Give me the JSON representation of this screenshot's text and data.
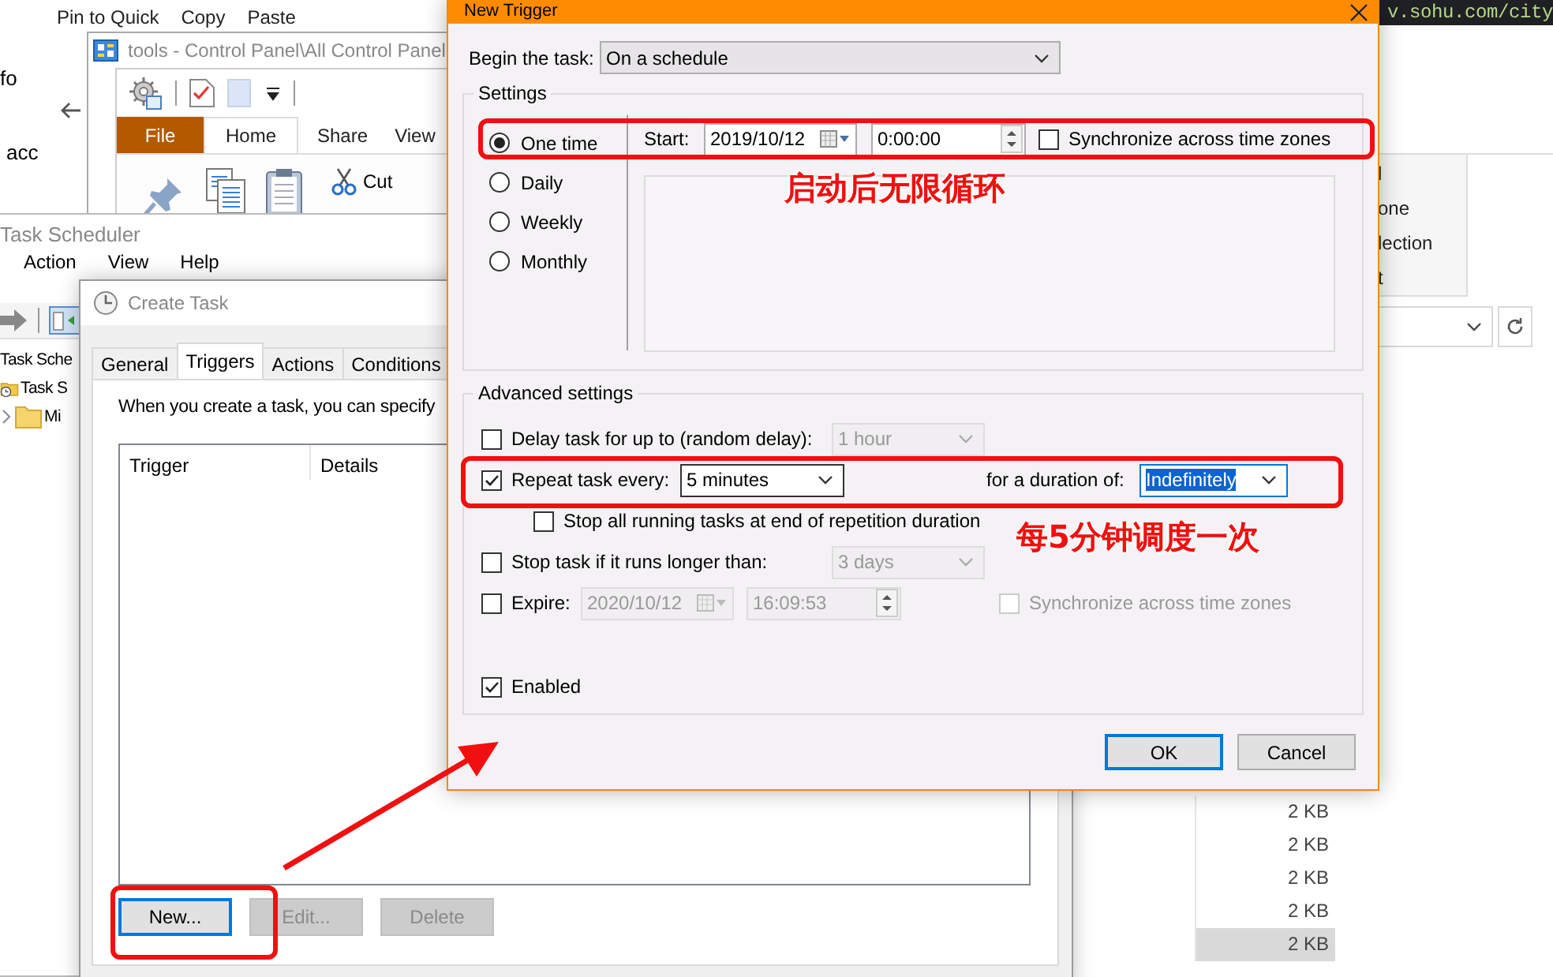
{
  "background_window": {
    "ribbon_labels": [
      "Pin to Quick",
      "Copy",
      "Paste"
    ],
    "side_texts": [
      "fo",
      "acc"
    ],
    "url_text": "v.sohu.com/city",
    "ribbon_fragments": [
      "l",
      "one",
      "lection",
      "t"
    ],
    "files": [
      {
        "size": "2 KB",
        "selected": false
      },
      {
        "size": "2 KB",
        "selected": false
      },
      {
        "size": "2 KB",
        "selected": false
      },
      {
        "size": "2 KB",
        "selected": false
      },
      {
        "size": "2 KB",
        "selected": true
      }
    ]
  },
  "tools_window": {
    "title": "tools - Control Panel\\All Control Panel",
    "ribbon_tabs": [
      {
        "label": "File",
        "kind": "file",
        "selected": false
      },
      {
        "label": "Home",
        "kind": "tab",
        "selected": true
      },
      {
        "label": "Share",
        "kind": "tab",
        "selected": false
      },
      {
        "label": "View",
        "kind": "tab",
        "selected": false
      }
    ],
    "commands": [
      "Cut"
    ]
  },
  "task_scheduler": {
    "title": "Task Scheduler",
    "menu": [
      "Action",
      "View",
      "Help"
    ],
    "pane_header": "Task Sche",
    "tree": [
      {
        "label": "Task S",
        "children": [
          {
            "label": "Mi",
            "expanded": false
          }
        ]
      }
    ]
  },
  "create_task": {
    "title": "Create Task",
    "tabs": [
      {
        "label": "General",
        "selected": false
      },
      {
        "label": "Triggers",
        "selected": true
      },
      {
        "label": "Actions",
        "selected": false
      },
      {
        "label": "Conditions",
        "selected": false
      }
    ],
    "intro": "When you create a task, you can specify",
    "columns": [
      "Trigger",
      "Details"
    ],
    "buttons": [
      {
        "label": "New...",
        "disabled": false,
        "focused": true
      },
      {
        "label": "Edit...",
        "disabled": true,
        "focused": false
      },
      {
        "label": "Delete",
        "disabled": true,
        "focused": false
      }
    ]
  },
  "new_trigger": {
    "title": "New Trigger",
    "begin_label": "Begin the task:",
    "begin_value": "On a schedule",
    "settings": {
      "title": "Settings",
      "schedules": [
        {
          "label": "One time",
          "selected": true
        },
        {
          "label": "Daily",
          "selected": false
        },
        {
          "label": "Weekly",
          "selected": false
        },
        {
          "label": "Monthly",
          "selected": false
        }
      ],
      "start_label": "Start:",
      "start_date": "2019/10/12",
      "start_time": "0:00:00",
      "sync_label": "Synchronize across time zones",
      "sync_checked": false
    },
    "advanced": {
      "title": "Advanced settings",
      "rows": [
        {
          "kind": "option",
          "label": "Delay task for up to (random delay):",
          "checked": false,
          "value": "1 hour",
          "disabled": true
        },
        {
          "kind": "repeat",
          "label": "Repeat task every:",
          "checked": true,
          "value": "5 minutes",
          "duration_label": "for a duration of:",
          "duration_value": "Indefinitely",
          "duration_highlighted": true
        },
        {
          "kind": "sub",
          "label": "Stop all running tasks at end of repetition duration",
          "checked": false
        },
        {
          "kind": "option",
          "label": "Stop task if it runs longer than:",
          "checked": false,
          "value": "3 days",
          "disabled": true
        },
        {
          "kind": "expire",
          "label": "Expire:",
          "checked": false,
          "date": "2020/10/12",
          "time": "16:09:53",
          "disabled": true,
          "sync_label": "Synchronize across time zones",
          "sync_checked": false
        },
        {
          "kind": "flag",
          "label": "Enabled",
          "checked": true
        }
      ]
    },
    "buttons": [
      {
        "label": "OK",
        "focused": true
      },
      {
        "label": "Cancel",
        "focused": false
      }
    ]
  },
  "annotations": [
    {
      "text": "启动后无限循环"
    },
    {
      "text": "每5分钟调度一次"
    }
  ]
}
